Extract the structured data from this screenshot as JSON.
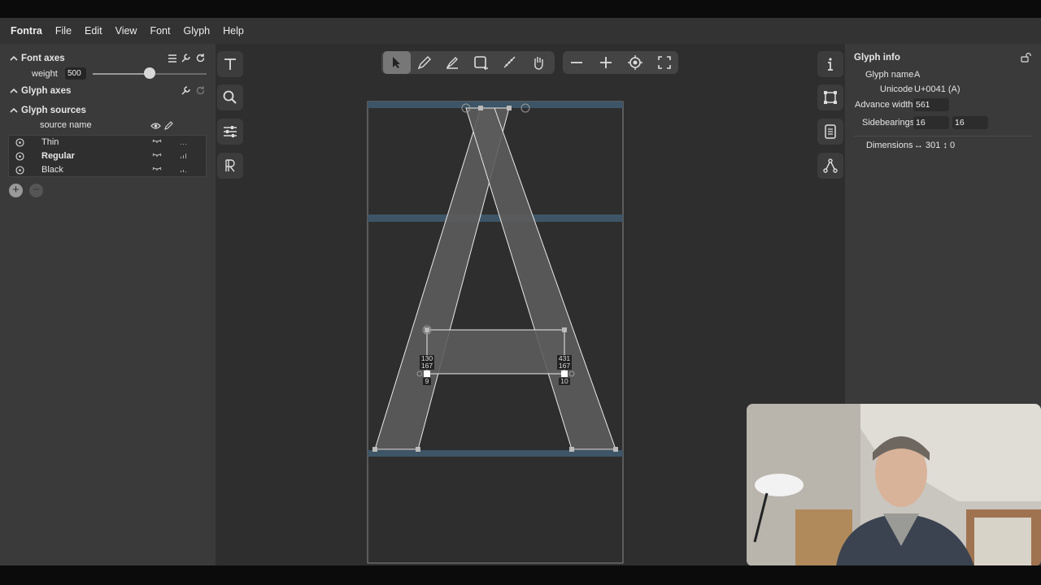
{
  "menu": {
    "app_name": "Fontra",
    "items": [
      "File",
      "Edit",
      "View",
      "Font",
      "Glyph",
      "Help"
    ]
  },
  "left_panel": {
    "font_axes_title": "Font axes",
    "weight_label": "weight",
    "weight_value": "500",
    "weight_fraction": 0.5,
    "glyph_axes_title": "Glyph axes",
    "glyph_sources_title": "Glyph sources",
    "source_name_header": "source name",
    "sources": [
      {
        "name": "Thin",
        "bold": false
      },
      {
        "name": "Regular",
        "bold": true
      },
      {
        "name": "Black",
        "bold": false
      }
    ]
  },
  "canvas": {
    "point_labels": [
      {
        "line1": "130",
        "line2": "167",
        "index": "9"
      },
      {
        "line1": "431",
        "line2": "167",
        "index": "10"
      }
    ]
  },
  "glyph_info": {
    "title": "Glyph info",
    "glyph_name_label": "Glyph name",
    "glyph_name_value": "A",
    "unicode_label": "Unicode",
    "unicode_value": "U+0041 (A)",
    "advance_width_label": "Advance width",
    "advance_width_value": "561",
    "sidebearings_label": "Sidebearings",
    "sidebearing_left": "16",
    "sidebearing_right": "16",
    "dimensions_label": "Dimensions",
    "dimensions_value": "↔ 301 ↕ 0"
  },
  "colors": {
    "canvas_bg": "#2e2e2e",
    "panel_bg": "#3a3a3a",
    "glyph_fill": "#5c5c5c",
    "metric_line": "#3d5566"
  }
}
